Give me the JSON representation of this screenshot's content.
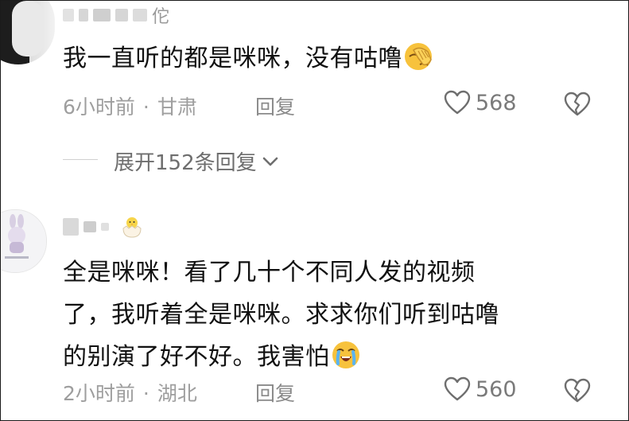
{
  "comments": [
    {
      "username_visible": "佗",
      "text": "我一直听的都是咪咪，没有咕噜",
      "emoji": "facepalm-emoji",
      "time": "6小时前",
      "location": "甘肃",
      "reply_label": "回复",
      "likes": "568",
      "expand_label": "展开152条回复"
    },
    {
      "text_line1": "全是咪咪！看了几十个不同人发的视频",
      "text_line2": "了，我听着全是咪咪。求求你们听到咕噜",
      "text_line3": "的别演了好不好。我害怕",
      "emoji": "crying-face-emoji",
      "badge_emoji": "hatching-chick-emoji",
      "time": "2小时前",
      "location": "湖北",
      "reply_label": "回复",
      "likes": "560"
    }
  ],
  "meta_separator": "·",
  "colors": {
    "text": "#111111",
    "meta": "#9e9e9e",
    "emoji_yellow": "#f7c23c"
  }
}
